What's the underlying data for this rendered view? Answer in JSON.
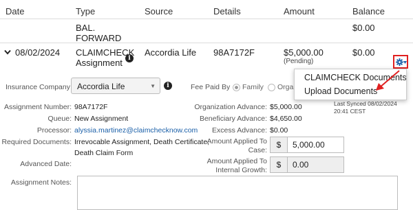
{
  "table": {
    "headers": {
      "date": "Date",
      "type": "Type",
      "source": "Source",
      "details": "Details",
      "amount": "Amount",
      "balance": "Balance"
    },
    "row1": {
      "type_line1": "BAL.",
      "type_line2": "FORWARD",
      "balance": "$0.00"
    },
    "row2": {
      "date": "08/02/2024",
      "type_line1": "CLAIMCHECK",
      "type_line2": "Assignment",
      "source": "Accordia Life",
      "details": "98A7172F",
      "amount": "$5,000.00",
      "amount_status": "(Pending)",
      "balance": "$0.00"
    }
  },
  "form": {
    "insurance_company_label": "Insurance Company",
    "insurance_company_value": "Accordia Life",
    "fee_paid_by_label": "Fee Paid By",
    "fee_option_family": "Family",
    "fee_option_org": "Orga",
    "assignment_number_label": "Assignment Number:",
    "assignment_number": "98A7172F",
    "queue_label": "Queue:",
    "queue": "New Assignment",
    "processor_label": "Processor:",
    "processor": "alyssia.martinez@claimchecknow.com",
    "required_docs_label": "Required Documents:",
    "required_docs_line1": "Irrevocable Assignment, Death Certificate,",
    "required_docs_line2": "Death Claim Form",
    "advanced_date_label": "Advanced Date:",
    "assignment_notes_label": "Assignment Notes:",
    "org_advance_label": "Organization Advance:",
    "org_advance": "$5,000.00",
    "beneficiary_advance_label": "Beneficiary Advance:",
    "beneficiary_advance": "$4,650.00",
    "excess_advance_label": "Excess Advance:",
    "excess_advance": "$0.00",
    "applied_case_label_1": "Amount Applied To",
    "applied_case_label_2": "Case:",
    "applied_case_prefix": "$",
    "applied_case_value": "5,000.00",
    "applied_growth_label_1": "Amount Applied To",
    "applied_growth_label_2": "Internal Growth:",
    "applied_growth_prefix": "$",
    "applied_growth_value": "0.00",
    "last_synced_line1": "Last Synced 08/02/2024",
    "last_synced_line2": "20:41 CEST"
  },
  "menu": {
    "item1": "CLAIMCHECK Documents",
    "item2": "Upload Documents"
  },
  "colors": {
    "highlight": "#e02020",
    "link": "#1a5fa8",
    "gear": "#1a5fa8"
  },
  "icons": {
    "expand": "chevron-down-icon",
    "info": "info-icon",
    "settings": "gear-icon",
    "arrow": "red-arrow"
  }
}
